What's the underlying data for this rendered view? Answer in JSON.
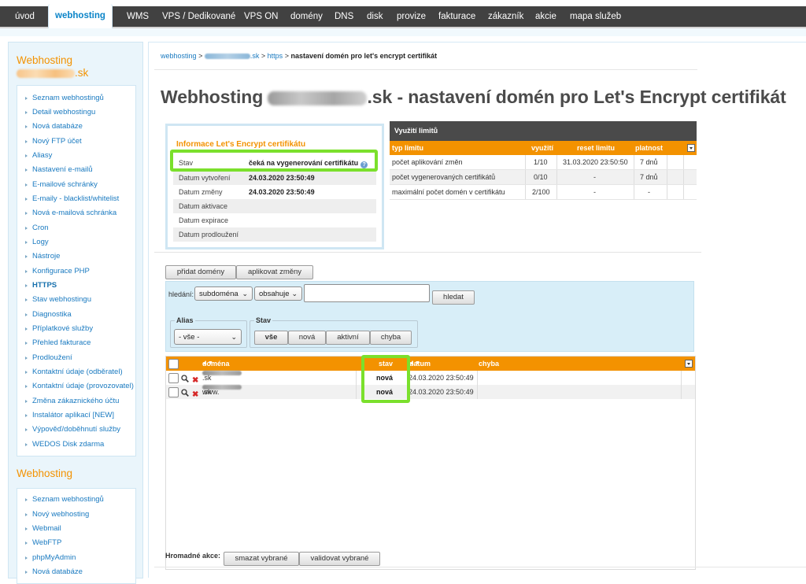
{
  "nav": {
    "items": [
      {
        "label": "úvod"
      },
      {
        "label": "webhosting"
      },
      {
        "label": "WMS"
      },
      {
        "label": "VPS / Dedikované"
      },
      {
        "label": "VPS ON"
      },
      {
        "label": "domény"
      },
      {
        "label": "DNS"
      },
      {
        "label": "disk"
      },
      {
        "label": "provize"
      },
      {
        "label": "fakturace"
      },
      {
        "label": "zákazník"
      },
      {
        "label": "akcie"
      },
      {
        "label": "mapa služeb"
      }
    ]
  },
  "sidebar": {
    "section1_title": "Webhosting",
    "section1_domain_suffix": ".sk",
    "section1_items": [
      {
        "label": "Seznam webhostingů"
      },
      {
        "label": "Detail webhostingu"
      },
      {
        "label": "Nová databáze"
      },
      {
        "label": "Nový FTP účet"
      },
      {
        "label": "Aliasy"
      },
      {
        "label": "Nastavení e-mailů"
      },
      {
        "label": "E-mailové schránky"
      },
      {
        "label": "E-maily - blacklist/whitelist"
      },
      {
        "label": "Nová e-mailová schránka"
      },
      {
        "label": "Cron"
      },
      {
        "label": "Logy"
      },
      {
        "label": "Nástroje"
      },
      {
        "label": "Konfigurace PHP"
      },
      {
        "label": "HTTPS"
      },
      {
        "label": "Stav webhostingu"
      },
      {
        "label": "Diagnostika"
      },
      {
        "label": "Příplatkové služby"
      },
      {
        "label": "Přehled fakturace"
      },
      {
        "label": "Prodloužení"
      },
      {
        "label": "Kontaktní údaje (odběratel)"
      },
      {
        "label": "Kontaktní údaje (provozovatel)"
      },
      {
        "label": "Změna zákaznického účtu"
      },
      {
        "label": "Instalátor aplikací [NEW]"
      },
      {
        "label": "Výpověď/doběhnutí služby"
      },
      {
        "label": "WEDOS Disk zdarma"
      }
    ],
    "section2_title": "Webhosting",
    "section2_items": [
      {
        "label": "Seznam webhostingů"
      },
      {
        "label": "Nový webhosting"
      },
      {
        "label": "Webmail"
      },
      {
        "label": "WebFTP"
      },
      {
        "label": "phpMyAdmin"
      },
      {
        "label": "Nová databáze"
      }
    ]
  },
  "breadcrumb": {
    "part1": "webhosting",
    "sep": ">",
    "part2_suffix": ".sk",
    "part3": "https",
    "current": "nastavení domén pro let's encrypt certifikát"
  },
  "title": {
    "prefix": "Webhosting",
    "suffix": ".sk - nastavení domén pro Let's Encrypt certifikát"
  },
  "cert_info": {
    "title": "Informace Let's Encrypt certifikátu",
    "rows": [
      {
        "key": "Stav",
        "value": "čeká na vygenerování certifikátu"
      },
      {
        "key": "Datum vytvoření",
        "value": "24.03.2020 23:50:49"
      },
      {
        "key": "Datum změny",
        "value": "24.03.2020 23:50:49"
      },
      {
        "key": "Datum aktivace",
        "value": ""
      },
      {
        "key": "Datum expirace",
        "value": ""
      },
      {
        "key": "Datum prodloužení",
        "value": ""
      }
    ]
  },
  "limits": {
    "title": "Využití limitů",
    "columns": [
      "typ limitu",
      "využití",
      "reset limitu",
      "platnost"
    ],
    "rows": [
      {
        "type": "počet aplikování změn",
        "usage": "1/10",
        "reset": "31.03.2020 23:50:50",
        "validity": "7 dnů"
      },
      {
        "type": "počet vygenerovaných certifikátů",
        "usage": "0/10",
        "reset": "-",
        "validity": "7 dnů"
      },
      {
        "type": "maximální počet domén v certifikátu",
        "usage": "2/100",
        "reset": "-",
        "validity": "-"
      }
    ]
  },
  "actions": {
    "add_domains": "přidat domény",
    "apply_changes": "aplikovat změny"
  },
  "search": {
    "label": "hledání:",
    "field_select": "subdoména",
    "op_select": "obsahuje",
    "value": "",
    "button": "hledat"
  },
  "filters": {
    "alias_label": "Alias",
    "alias_value": "- vše -",
    "state_label": "Stav",
    "state_buttons": [
      "vše",
      "nová",
      "aktivní",
      "chyba"
    ]
  },
  "domains": {
    "columns": {
      "domain": "doména",
      "state": "stav",
      "added": "datum přidání",
      "error": "chyba"
    },
    "rows": [
      {
        "domain_prefix": "",
        "domain_suffix": ".sk",
        "state": "nová",
        "added": "24.03.2020 23:50:49",
        "error": ""
      },
      {
        "domain_prefix": "www.",
        "domain_suffix": ".sk",
        "state": "nová",
        "added": "24.03.2020 23:50:49",
        "error": ""
      }
    ]
  },
  "bulk": {
    "label": "Hromadné akce:",
    "delete": "smazat vybrané",
    "validate": "validovat vybrané"
  },
  "colors": {
    "accent": "#f39200",
    "link": "#1a7ac0",
    "highlight": "#7be02c",
    "nav_bg": "#414141"
  }
}
